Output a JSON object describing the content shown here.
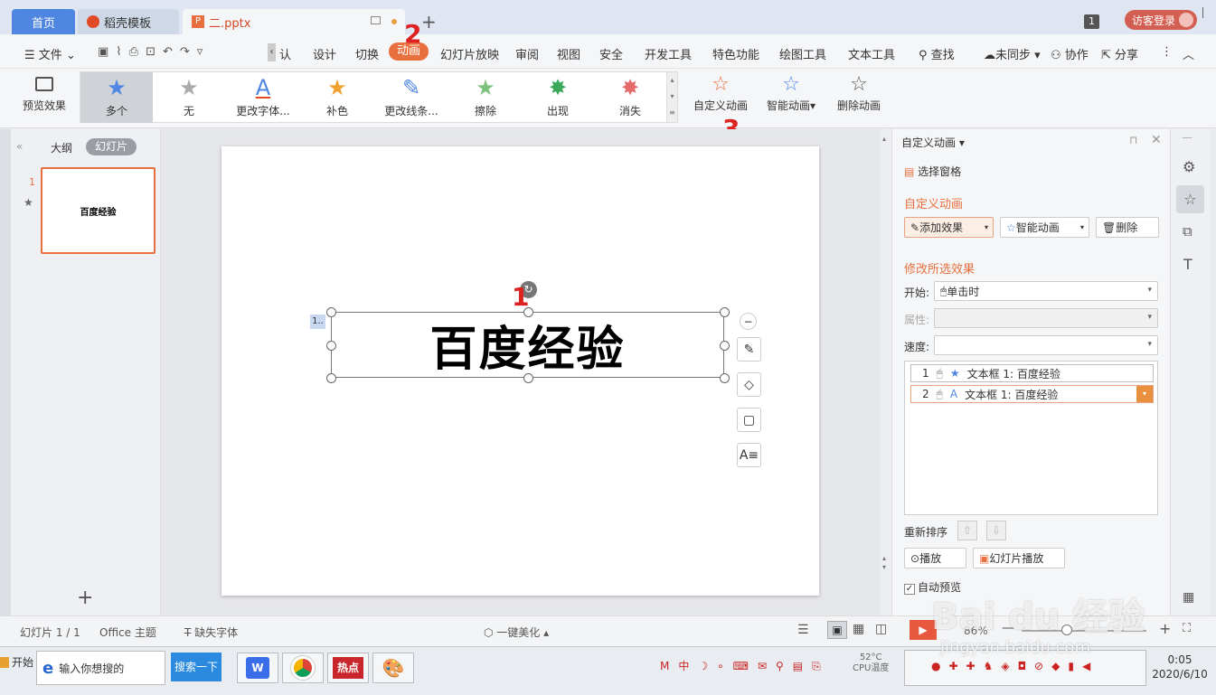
{
  "tabs": {
    "home": "首页",
    "template": "稻壳模板",
    "file": "二.pptx",
    "count": "1",
    "login": "访客登录"
  },
  "menu": {
    "file": "文件",
    "insert_partial": "认",
    "design": "设计",
    "transition": "切换",
    "animation": "动画",
    "slideshow": "幻灯片放映",
    "review": "审阅",
    "view": "视图",
    "security": "安全",
    "dev": "开发工具",
    "special": "特色功能",
    "draw": "绘图工具",
    "text": "文本工具",
    "search": "查找",
    "sync": "未同步",
    "collab": "协作",
    "share": "分享"
  },
  "ribbon": {
    "preview": "预览效果",
    "gallery": [
      "多个",
      "无",
      "更改字体...",
      "补色",
      "更改线条...",
      "擦除",
      "出现",
      "消失"
    ],
    "custom_anim": "自定义动画",
    "smart_anim": "智能动画",
    "delete_anim": "删除动画"
  },
  "annotations": {
    "n1": "1",
    "n2": "2",
    "n3": "3"
  },
  "left_panel": {
    "outline": "大纲",
    "slides": "幻灯片",
    "slide_num": "1",
    "thumb_text": "百度经验",
    "add": "+"
  },
  "slide": {
    "title": "百度经验",
    "anim_tag": "1.."
  },
  "right_panel": {
    "header": "自定义动画",
    "select_pane": "选择窗格",
    "section_custom": "自定义动画",
    "add_effect": "添加效果",
    "smart_anim": "智能动画",
    "delete": "删除",
    "section_modify": "修改所选效果",
    "start_label": "开始:",
    "start_value": "单击时",
    "property_label": "属性:",
    "speed_label": "速度:",
    "items": [
      {
        "num": "1",
        "label": "文本框 1: 百度经验"
      },
      {
        "num": "2",
        "label": "文本框 1: 百度经验"
      }
    ],
    "reorder": "重新排序",
    "play": "播放",
    "slideshow": "幻灯片播放",
    "auto_preview": "自动预览"
  },
  "status": {
    "slide_info": "幻灯片 1 / 1",
    "theme": "Office 主题",
    "missing_font": "缺失字体",
    "beautify": "一键美化",
    "zoom": "86%"
  },
  "taskbar": {
    "start": "开始",
    "search_placeholder": "输入你想搜的",
    "search_btn": "搜索一下",
    "hot": "热点",
    "cpu": "CPU温度",
    "temp": "52°C",
    "time": "0:05",
    "date": "2020/6/10"
  },
  "watermark": {
    "text": "jingyan.baidu.com"
  },
  "colors": {
    "accent": "#e8703e",
    "blue": "#4f86e2",
    "annotation": "#dd2222"
  }
}
